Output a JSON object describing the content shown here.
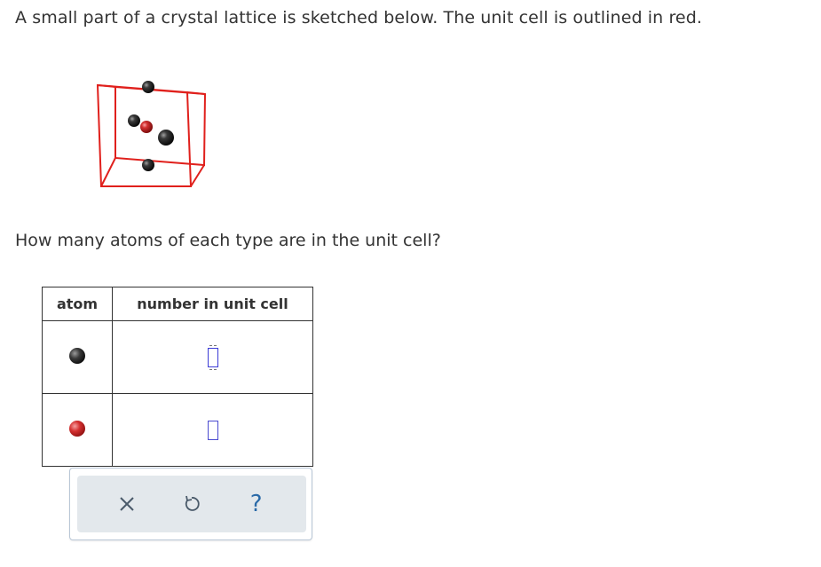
{
  "intro_text": "A small part of a crystal lattice is sketched below. The unit cell is outlined in red.",
  "question_text": "How many atoms of each type are in the unit cell?",
  "table": {
    "headers": [
      "atom",
      "number in unit cell"
    ],
    "rows": [
      {
        "atom": "black-atom",
        "value": ""
      },
      {
        "atom": "red-atom",
        "value": ""
      }
    ]
  },
  "toolbar": {
    "clear_icon": "x-icon",
    "undo_icon": "undo-icon",
    "help_icon": "question-mark-icon",
    "help_label": "?"
  },
  "colors": {
    "unit_cell_outline": "#e0201c",
    "black_atom": "#1a1a1a",
    "red_atom": "#c62828",
    "answer_box_border": "#4a4ad0"
  }
}
